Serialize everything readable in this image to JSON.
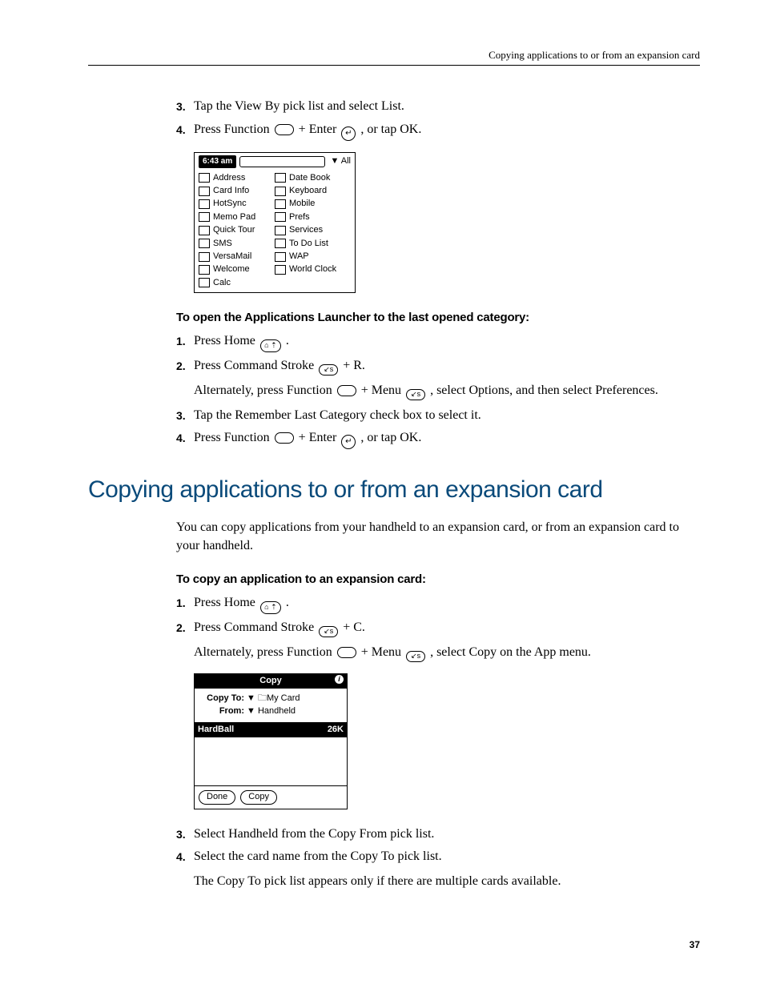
{
  "header": {
    "running_title": "Copying applications to or from an expansion card"
  },
  "steps_pre": [
    {
      "n": "3.",
      "body": "Tap the View By pick list and select List."
    },
    {
      "n": "4.",
      "body_parts": [
        "Press Function ",
        {
          "icon": "function"
        },
        " + Enter ",
        {
          "icon": "enter"
        },
        " , or tap OK."
      ]
    }
  ],
  "launcher": {
    "time": "6:43 am",
    "picklist": "▼ All",
    "left": [
      "Address",
      "Card Info",
      "HotSync",
      "Memo Pad",
      "Quick Tour",
      "SMS",
      "VersaMail",
      "Welcome",
      "Calc"
    ],
    "right": [
      "Date Book",
      "Keyboard",
      "Mobile",
      "Prefs",
      "Services",
      "To Do List",
      "WAP",
      "World Clock"
    ]
  },
  "subhead1": "To open the Applications Launcher to the last opened category:",
  "steps_a": [
    {
      "n": "1.",
      "body_parts": [
        "Press Home ",
        {
          "icon": "home"
        },
        " ."
      ]
    },
    {
      "n": "2.",
      "body_parts": [
        "Press Command Stroke ",
        {
          "icon": "cmd"
        },
        " + R."
      ]
    }
  ],
  "alt1_parts": [
    "Alternately, press Function ",
    {
      "icon": "function"
    },
    " + Menu ",
    {
      "icon": "cmd"
    },
    " , select Options, and then select Preferences."
  ],
  "steps_b": [
    {
      "n": "3.",
      "body": "Tap the Remember Last Category check box to select it."
    },
    {
      "n": "4.",
      "body_parts": [
        "Press Function ",
        {
          "icon": "function"
        },
        " + Enter ",
        {
          "icon": "enter"
        },
        " , or tap OK."
      ]
    }
  ],
  "section_h2": "Copying applications to or from an expansion card",
  "intro": "You can copy applications from your handheld to an expansion card, or from an expansion card to your handheld.",
  "subhead2": "To copy an application to an expansion card:",
  "steps_c": [
    {
      "n": "1.",
      "body_parts": [
        "Press Home ",
        {
          "icon": "home"
        },
        " ."
      ]
    },
    {
      "n": "2.",
      "body_parts": [
        "Press Command Stroke ",
        {
          "icon": "cmd"
        },
        " + C."
      ]
    }
  ],
  "alt2_parts": [
    "Alternately, press Function ",
    {
      "icon": "function"
    },
    " + Menu ",
    {
      "icon": "cmd"
    },
    " , select Copy on the App menu."
  ],
  "copydlg": {
    "title": "Copy",
    "copy_to_label": "Copy To:",
    "copy_to_value": "▼ 🗀My Card",
    "from_label": "From:",
    "from_value": "▼ Handheld",
    "item_name": "HardBall",
    "item_size": "26K",
    "done": "Done",
    "copy": "Copy"
  },
  "steps_d": [
    {
      "n": "3.",
      "body": "Select Handheld from the Copy From pick list."
    },
    {
      "n": "4.",
      "body": "Select the card name from the Copy To pick list."
    }
  ],
  "tail_para": "The Copy To pick list appears only if there are multiple cards available.",
  "page_number": "37"
}
